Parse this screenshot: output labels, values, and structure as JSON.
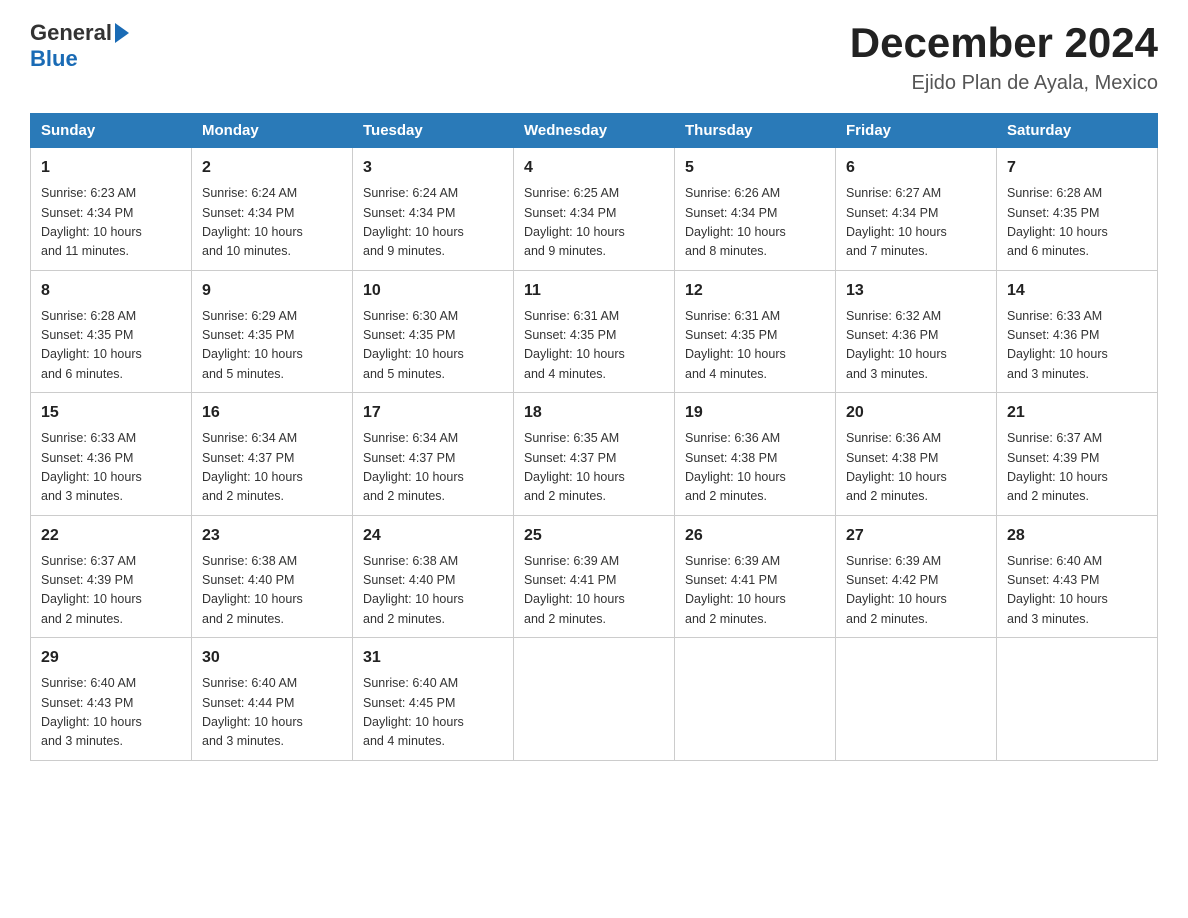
{
  "header": {
    "logo": {
      "general": "General",
      "blue": "Blue"
    },
    "title": "December 2024",
    "subtitle": "Ejido Plan de Ayala, Mexico"
  },
  "weekdays": [
    "Sunday",
    "Monday",
    "Tuesday",
    "Wednesday",
    "Thursday",
    "Friday",
    "Saturday"
  ],
  "weeks": [
    [
      {
        "day": "1",
        "sunrise": "6:23 AM",
        "sunset": "4:34 PM",
        "daylight": "10 hours and 11 minutes."
      },
      {
        "day": "2",
        "sunrise": "6:24 AM",
        "sunset": "4:34 PM",
        "daylight": "10 hours and 10 minutes."
      },
      {
        "day": "3",
        "sunrise": "6:24 AM",
        "sunset": "4:34 PM",
        "daylight": "10 hours and 9 minutes."
      },
      {
        "day": "4",
        "sunrise": "6:25 AM",
        "sunset": "4:34 PM",
        "daylight": "10 hours and 9 minutes."
      },
      {
        "day": "5",
        "sunrise": "6:26 AM",
        "sunset": "4:34 PM",
        "daylight": "10 hours and 8 minutes."
      },
      {
        "day": "6",
        "sunrise": "6:27 AM",
        "sunset": "4:34 PM",
        "daylight": "10 hours and 7 minutes."
      },
      {
        "day": "7",
        "sunrise": "6:28 AM",
        "sunset": "4:35 PM",
        "daylight": "10 hours and 6 minutes."
      }
    ],
    [
      {
        "day": "8",
        "sunrise": "6:28 AM",
        "sunset": "4:35 PM",
        "daylight": "10 hours and 6 minutes."
      },
      {
        "day": "9",
        "sunrise": "6:29 AM",
        "sunset": "4:35 PM",
        "daylight": "10 hours and 5 minutes."
      },
      {
        "day": "10",
        "sunrise": "6:30 AM",
        "sunset": "4:35 PM",
        "daylight": "10 hours and 5 minutes."
      },
      {
        "day": "11",
        "sunrise": "6:31 AM",
        "sunset": "4:35 PM",
        "daylight": "10 hours and 4 minutes."
      },
      {
        "day": "12",
        "sunrise": "6:31 AM",
        "sunset": "4:35 PM",
        "daylight": "10 hours and 4 minutes."
      },
      {
        "day": "13",
        "sunrise": "6:32 AM",
        "sunset": "4:36 PM",
        "daylight": "10 hours and 3 minutes."
      },
      {
        "day": "14",
        "sunrise": "6:33 AM",
        "sunset": "4:36 PM",
        "daylight": "10 hours and 3 minutes."
      }
    ],
    [
      {
        "day": "15",
        "sunrise": "6:33 AM",
        "sunset": "4:36 PM",
        "daylight": "10 hours and 3 minutes."
      },
      {
        "day": "16",
        "sunrise": "6:34 AM",
        "sunset": "4:37 PM",
        "daylight": "10 hours and 2 minutes."
      },
      {
        "day": "17",
        "sunrise": "6:34 AM",
        "sunset": "4:37 PM",
        "daylight": "10 hours and 2 minutes."
      },
      {
        "day": "18",
        "sunrise": "6:35 AM",
        "sunset": "4:37 PM",
        "daylight": "10 hours and 2 minutes."
      },
      {
        "day": "19",
        "sunrise": "6:36 AM",
        "sunset": "4:38 PM",
        "daylight": "10 hours and 2 minutes."
      },
      {
        "day": "20",
        "sunrise": "6:36 AM",
        "sunset": "4:38 PM",
        "daylight": "10 hours and 2 minutes."
      },
      {
        "day": "21",
        "sunrise": "6:37 AM",
        "sunset": "4:39 PM",
        "daylight": "10 hours and 2 minutes."
      }
    ],
    [
      {
        "day": "22",
        "sunrise": "6:37 AM",
        "sunset": "4:39 PM",
        "daylight": "10 hours and 2 minutes."
      },
      {
        "day": "23",
        "sunrise": "6:38 AM",
        "sunset": "4:40 PM",
        "daylight": "10 hours and 2 minutes."
      },
      {
        "day": "24",
        "sunrise": "6:38 AM",
        "sunset": "4:40 PM",
        "daylight": "10 hours and 2 minutes."
      },
      {
        "day": "25",
        "sunrise": "6:39 AM",
        "sunset": "4:41 PM",
        "daylight": "10 hours and 2 minutes."
      },
      {
        "day": "26",
        "sunrise": "6:39 AM",
        "sunset": "4:41 PM",
        "daylight": "10 hours and 2 minutes."
      },
      {
        "day": "27",
        "sunrise": "6:39 AM",
        "sunset": "4:42 PM",
        "daylight": "10 hours and 2 minutes."
      },
      {
        "day": "28",
        "sunrise": "6:40 AM",
        "sunset": "4:43 PM",
        "daylight": "10 hours and 3 minutes."
      }
    ],
    [
      {
        "day": "29",
        "sunrise": "6:40 AM",
        "sunset": "4:43 PM",
        "daylight": "10 hours and 3 minutes."
      },
      {
        "day": "30",
        "sunrise": "6:40 AM",
        "sunset": "4:44 PM",
        "daylight": "10 hours and 3 minutes."
      },
      {
        "day": "31",
        "sunrise": "6:40 AM",
        "sunset": "4:45 PM",
        "daylight": "10 hours and 4 minutes."
      },
      null,
      null,
      null,
      null
    ]
  ]
}
